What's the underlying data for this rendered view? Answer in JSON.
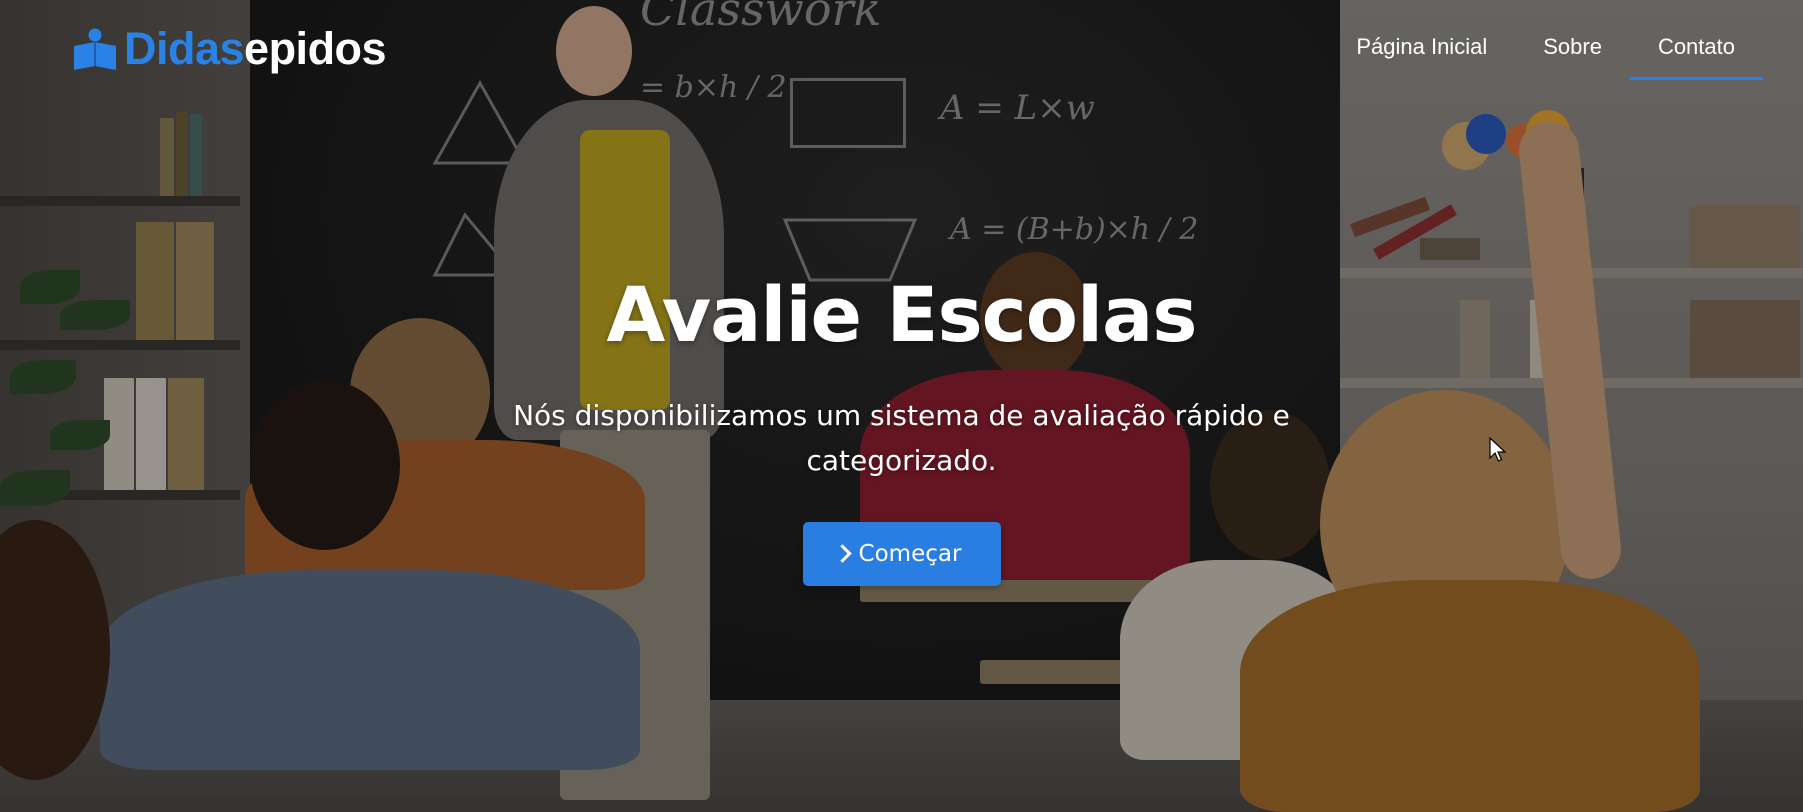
{
  "brand": {
    "name_part_1": "Didas",
    "name_part_2": "epidos",
    "icon": "students-group-icon",
    "accent_color": "#2a82e4"
  },
  "nav": {
    "items": [
      {
        "label": "Página Inicial",
        "active": false
      },
      {
        "label": "Sobre",
        "active": false
      },
      {
        "label": "Contato",
        "active": true
      }
    ]
  },
  "hero": {
    "title": "Avalie Escolas",
    "subtitle": "Nós disponibilizamos um sistema de avaliação rápido e categorizado.",
    "cta": {
      "label": "Começar",
      "icon": "chevron-right-icon",
      "color": "#2a7de1"
    },
    "background": "classroom-photo"
  },
  "chalkboard": {
    "top_text": "Classwork",
    "formula_triangle": "= b×h / 2",
    "formula_rect": "A = L×w",
    "formula_trapezoid": "A = (B+b)×h / 2"
  }
}
